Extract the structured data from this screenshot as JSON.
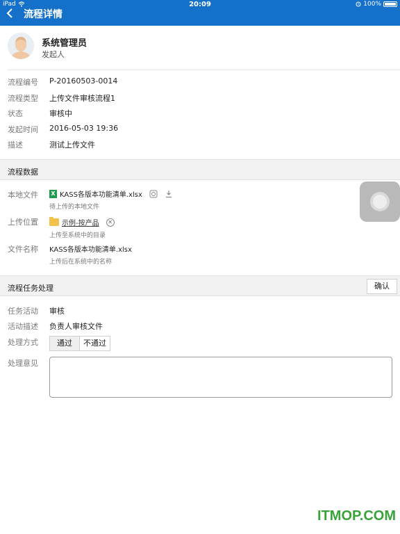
{
  "status_bar": {
    "carrier": "iPad",
    "time": "20:09",
    "battery": "100%"
  },
  "nav": {
    "title": "流程详情"
  },
  "user": {
    "name": "系统管理员",
    "role": "发起人"
  },
  "details": [
    {
      "label": "流程编号",
      "value": "P-20160503-0014"
    },
    {
      "label": "流程类型",
      "value": "上传文件审核流程1"
    },
    {
      "label": "状态",
      "value": "审核中"
    },
    {
      "label": "发起时间",
      "value": "2016-05-03 19:36"
    },
    {
      "label": "描述",
      "value": "测试上传文件"
    }
  ],
  "flow_data": {
    "title": "流程数据",
    "local_file": {
      "label": "本地文件",
      "file_name": "KASS各版本功能清单.xlsx",
      "hint": "待上传的本地文件"
    },
    "upload_location": {
      "label": "上传位置",
      "folder": "示例-按产品",
      "hint": "上传至系统中的目录"
    },
    "file_name": {
      "label": "文件名称",
      "value": "KASS各版本功能清单.xlsx",
      "hint": "上传后在系统中的名称"
    }
  },
  "task": {
    "title": "流程任务处理",
    "confirm_label": "确认",
    "activity_label": "任务活动",
    "activity_value": "审核",
    "desc_label": "活动描述",
    "desc_value": "负责人审核文件",
    "method_label": "处理方式",
    "option_pass": "通过",
    "option_reject": "不通过",
    "opinion_label": "处理意见",
    "opinion_value": ""
  },
  "watermark": "ITMOP.COM",
  "colors": {
    "nav_bg": "#1470c8",
    "excel_green": "#1e9b4f",
    "folder_yellow": "#f3c24d"
  },
  "icons": [
    "back-arrow-icon",
    "wifi-icon",
    "alarm-icon",
    "battery-icon",
    "excel-icon",
    "preview-icon",
    "download-icon",
    "folder-icon",
    "clear-icon",
    "assistive-touch-icon"
  ]
}
